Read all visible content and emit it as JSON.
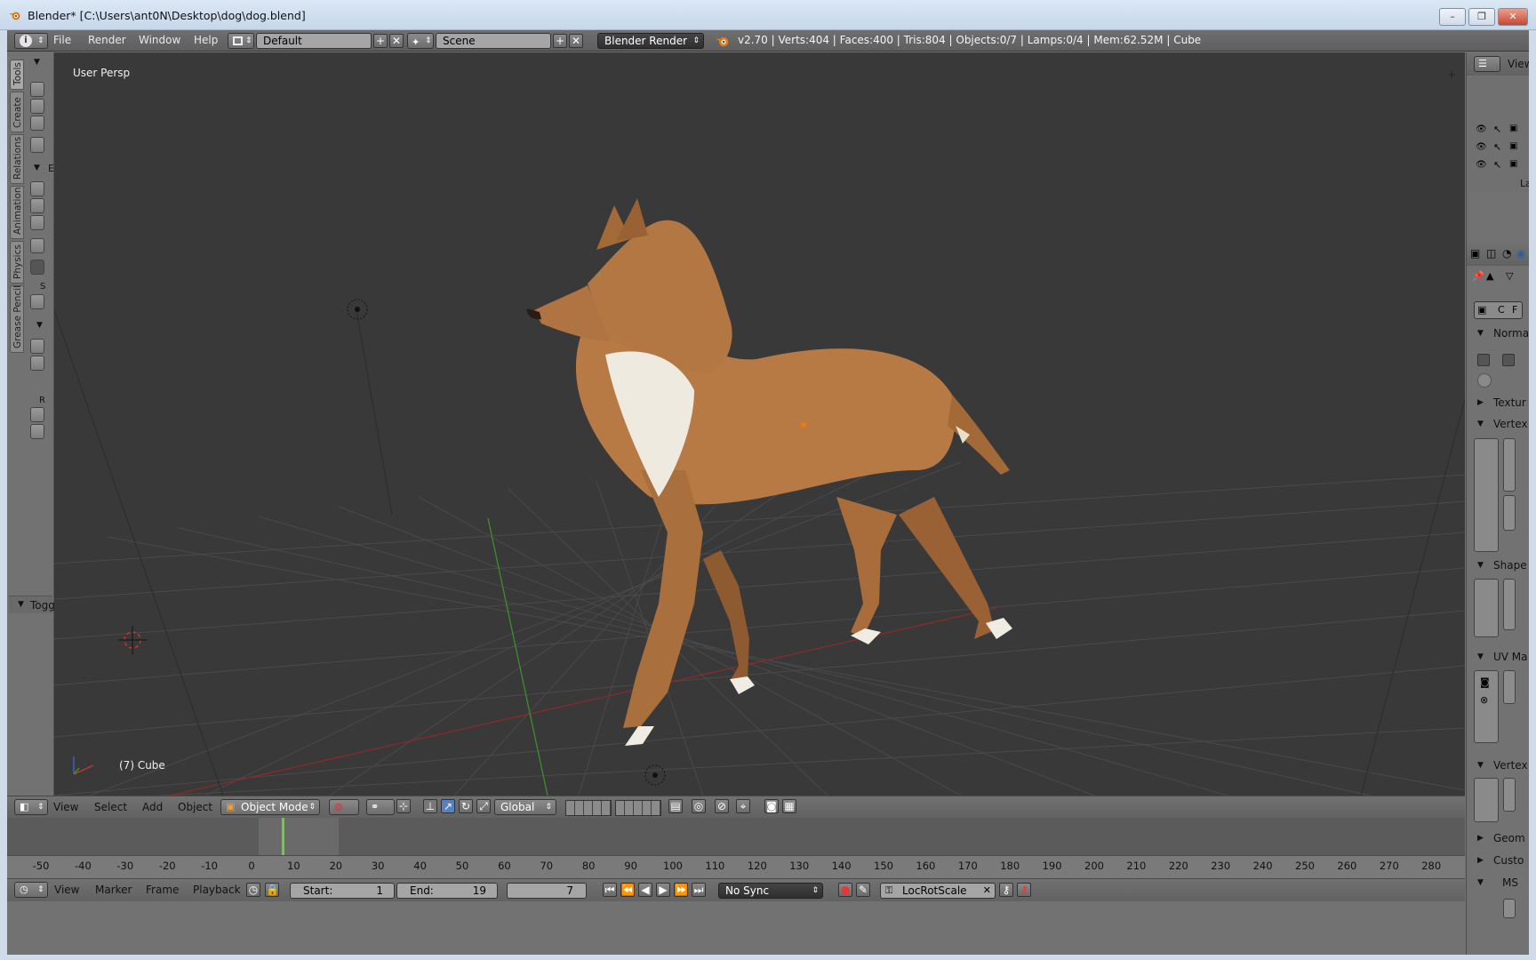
{
  "window": {
    "title": "Blender* [C:\\Users\\ant0N\\Desktop\\dog\\dog.blend]",
    "controls": [
      "–",
      "❐",
      "✕"
    ]
  },
  "info_header": {
    "menus": [
      "File",
      "Render",
      "Window",
      "Help"
    ],
    "screen_layout": "Default",
    "scene": "Scene",
    "render_engine": "Blender Render",
    "stats": "v2.70 | Verts:404 | Faces:400 | Tris:804 | Objects:0/7 | Lamps:0/4 | Mem:62.52M | Cube"
  },
  "tool_shelf": {
    "tabs": [
      "Tools",
      "Create",
      "Relations",
      "Animation",
      "Physics",
      "Grease Pencil"
    ],
    "fragments": [
      "E",
      "S",
      "R"
    ],
    "toggle_panel": "Togg"
  },
  "viewport": {
    "view_label": "User Persp",
    "object_label": "(7) Cube"
  },
  "view3d_header": {
    "menus": [
      "View",
      "Select",
      "Add",
      "Object"
    ],
    "mode": "Object Mode",
    "orientation": "Global"
  },
  "outliner": {
    "header_label": "View",
    "row_fragment": "Lam"
  },
  "properties": {
    "cf_buttons": [
      "C",
      "F"
    ],
    "panels": [
      "Norma",
      "Textur",
      "Vertex",
      "Shape",
      "UV Ma",
      "Vertex",
      "Geom",
      "Custo",
      "MS"
    ]
  },
  "timeline": {
    "ticks": [
      "-50",
      "-40",
      "-30",
      "-20",
      "-10",
      "0",
      "10",
      "20",
      "30",
      "40",
      "50",
      "60",
      "70",
      "80",
      "90",
      "100",
      "110",
      "120",
      "130",
      "140",
      "150",
      "160",
      "170",
      "180",
      "190",
      "200",
      "210",
      "220",
      "230",
      "240",
      "250",
      "260",
      "270",
      "280"
    ],
    "menus": [
      "View",
      "Marker",
      "Frame",
      "Playback"
    ],
    "start_label": "Start:",
    "start_value": "1",
    "end_label": "End:",
    "end_value": "19",
    "current_frame": "7",
    "sync": "No Sync",
    "keying_set": "LocRotScale"
  },
  "colors": {
    "viewport_bg": "#393939",
    "panel_bg": "#727272",
    "x_axis": "#8a2a2a",
    "y_axis": "#3c8f2c",
    "accent_blue": "#5680c2",
    "dog_fur": "#b87a45"
  }
}
